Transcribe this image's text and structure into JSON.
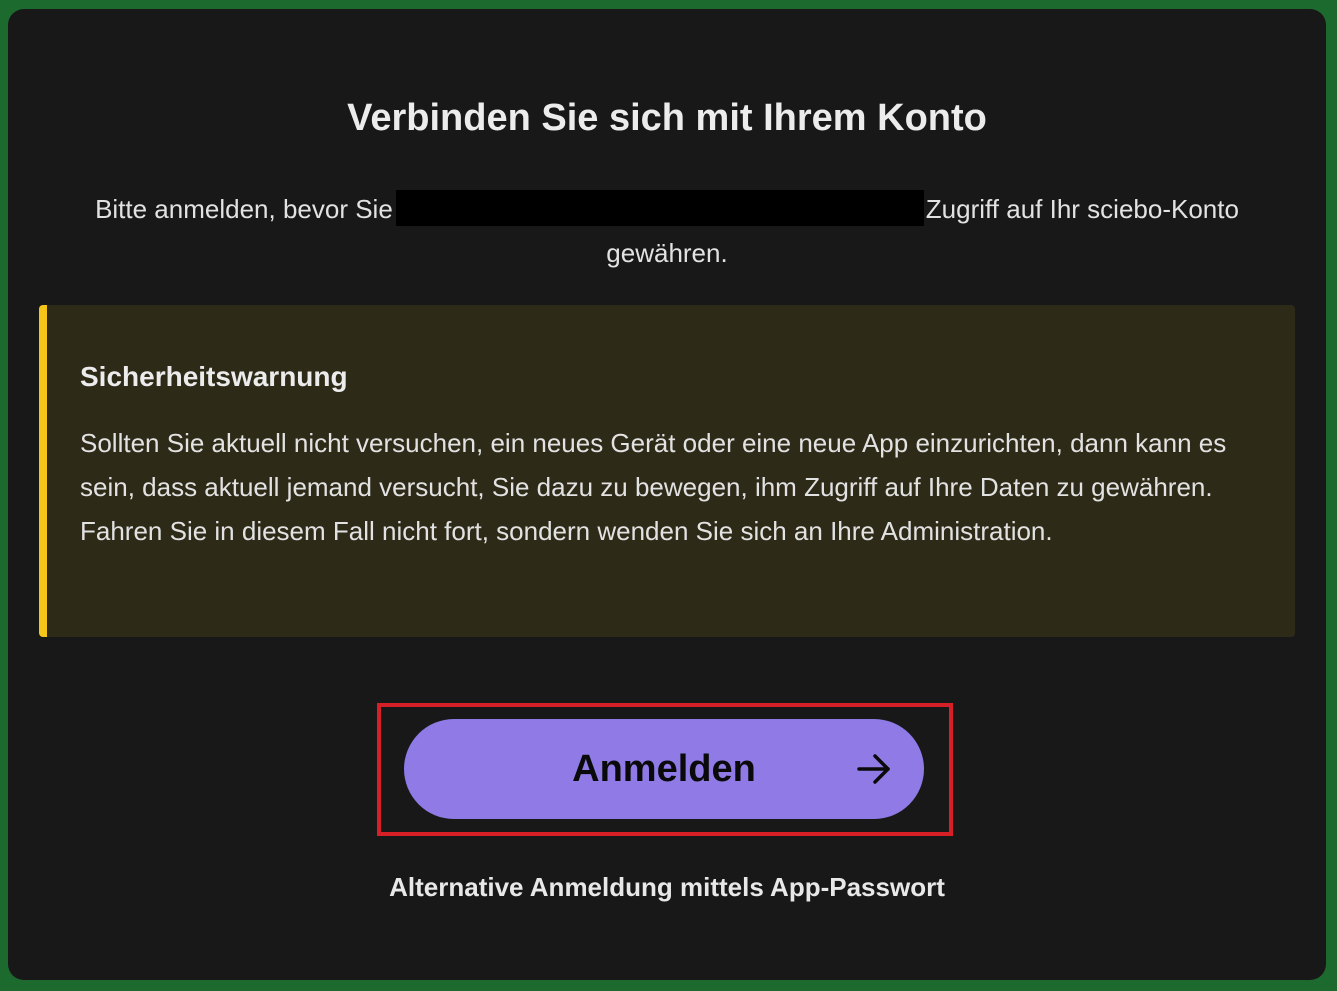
{
  "dialog": {
    "title": "Verbinden Sie sich mit Ihrem Konto",
    "intro_before": "Bitte anmelden, bevor Sie",
    "intro_after": "Zugriff auf Ihr sciebo-Konto",
    "intro_line2": "gewähren."
  },
  "warning": {
    "title": "Sicherheitswarnung",
    "text": "Sollten Sie aktuell nicht versuchen, ein neues Gerät oder eine neue App einzurichten, dann kann es sein, dass aktuell jemand versucht, Sie dazu zu bewegen, ihm Zugriff auf Ihre Daten zu gewähren. Fahren Sie in diesem Fall nicht fort, sondern wenden Sie sich an Ihre Administration.",
    "accent_color": "#f5c518",
    "background_color": "#2e2a18"
  },
  "login_button": {
    "label": "Anmelden",
    "icon": "arrow-right-icon",
    "color": "#8f7ae6"
  },
  "alt_login": {
    "label": "Alternative Anmeldung mittels App-Passwort"
  },
  "colors": {
    "card_background": "#181818",
    "outer_background": "#1c6a2e",
    "highlight_border": "#d61f26"
  }
}
